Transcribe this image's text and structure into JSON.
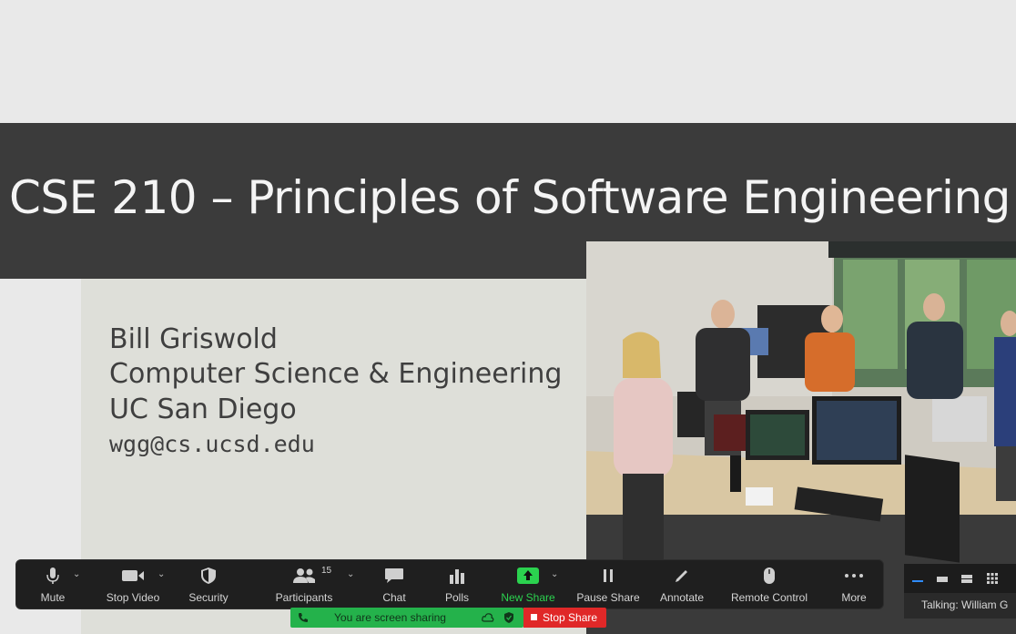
{
  "slide": {
    "title": "CSE 210 – Principles of Software Engineering",
    "author": "Bill Griswold",
    "department": "Computer Science & Engineering",
    "institution": "UC San Diego",
    "email": "wgg@cs.ucsd.edu"
  },
  "toolbar": {
    "mute": "Mute",
    "stop_video": "Stop Video",
    "security": "Security",
    "participants": "Participants",
    "participant_count": "15",
    "chat": "Chat",
    "polls": "Polls",
    "new_share": "New Share",
    "pause_share": "Pause Share",
    "annotate": "Annotate",
    "remote_control": "Remote Control",
    "more": "More"
  },
  "share_bar": {
    "status": "You are screen sharing",
    "stop_label": "Stop Share"
  },
  "speaker": {
    "talking": "Talking: William G"
  },
  "colors": {
    "toolbar_bg": "#1f1f1f",
    "share_green": "#24b24b",
    "stop_red": "#e02828",
    "title_bar": "#3b3b3b",
    "accent_green": "#2bd24f"
  }
}
